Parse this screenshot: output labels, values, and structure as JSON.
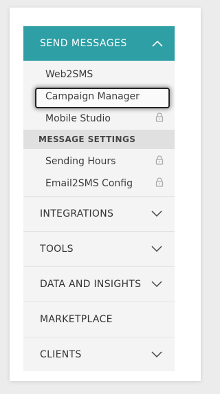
{
  "menu": {
    "send_messages": {
      "label": "SEND MESSAGES",
      "items": [
        {
          "label": "Web2SMS",
          "locked": false
        },
        {
          "label": "Campaign Manager",
          "locked": false
        },
        {
          "label": "Mobile Studio",
          "locked": true
        }
      ]
    },
    "message_settings": {
      "label": "MESSAGE SETTINGS",
      "items": [
        {
          "label": "Sending Hours",
          "locked": true
        },
        {
          "label": "Email2SMS Config",
          "locked": true
        }
      ]
    },
    "groups": [
      {
        "label": "INTEGRATIONS",
        "has_chevron": true
      },
      {
        "label": "TOOLS",
        "has_chevron": true
      },
      {
        "label": "DATA AND INSIGHTS",
        "has_chevron": true
      },
      {
        "label": "MARKETPLACE",
        "has_chevron": false
      },
      {
        "label": "CLIENTS",
        "has_chevron": true
      }
    ]
  },
  "colors": {
    "accent": "#2e9fa5",
    "menu_bg": "#f4f4f4",
    "settings_bg": "#e0e0e0"
  },
  "icons": {
    "collapse": "chevron-up-icon",
    "expand": "chevron-down-icon",
    "lock": "lock-icon"
  }
}
